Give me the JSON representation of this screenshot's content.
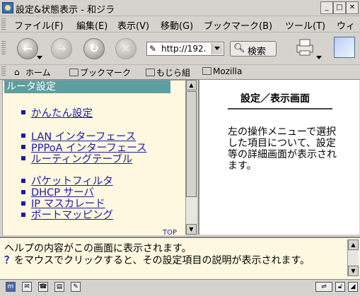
{
  "window": {
    "title": "設定&状態表示 - 和ジラ",
    "minimize_glyph": "_",
    "maximize_glyph": "□",
    "close_glyph": "✕"
  },
  "menu": {
    "items": [
      {
        "label": "ファイル(F)"
      },
      {
        "label": "編集(E)"
      },
      {
        "label": "表示(V)"
      },
      {
        "label": "移動(G)"
      },
      {
        "label": "ブックマーク(B)"
      },
      {
        "label": "ツール(T)"
      },
      {
        "label": "ウィ"
      }
    ]
  },
  "toolbar": {
    "back_glyph": "←",
    "forward_glyph": "→",
    "reload_glyph": "↻",
    "stop_glyph": "✕",
    "url_value": "http://192.",
    "search_label": "検索",
    "url_icon": "pencil-icon",
    "search_icon": "magnifier-icon"
  },
  "bookmarks": {
    "items": [
      {
        "label": "ホーム",
        "icon": "home-icon"
      },
      {
        "label": "ブックマーク",
        "icon": "folder-icon"
      },
      {
        "label": "もじら組",
        "icon": "folder-icon"
      },
      {
        "label": "Mozilla",
        "icon": "folder-icon"
      }
    ]
  },
  "left_frame": {
    "header": "ルータ設定",
    "links": [
      {
        "label": "かんたん設定"
      },
      {
        "label": "LAN インターフェース"
      },
      {
        "label": "PPPoA インターフェース"
      },
      {
        "label": "ルーティングテーブル"
      },
      {
        "label": "パケットフィルタ"
      },
      {
        "label": "DHCP サーバ"
      },
      {
        "label": "IP マスカレード"
      },
      {
        "label": "ポートマッピング"
      }
    ],
    "top_link": "TOP"
  },
  "right_frame": {
    "title": "設定／表示画面",
    "body": "左の操作メニューで選択した項目について、設定等の詳細画面が表示されます。"
  },
  "help": {
    "line1": "ヘルプの内容がこの画面に表示されます。",
    "line2_prefix": "？",
    "line2": "をマウスでクリックすると、その設定項目の説明が表示されます。"
  },
  "colors": {
    "left_header_bg": "#5f9ea0",
    "link": "#1a1aa6",
    "pane_bg": "#fff8e0"
  }
}
